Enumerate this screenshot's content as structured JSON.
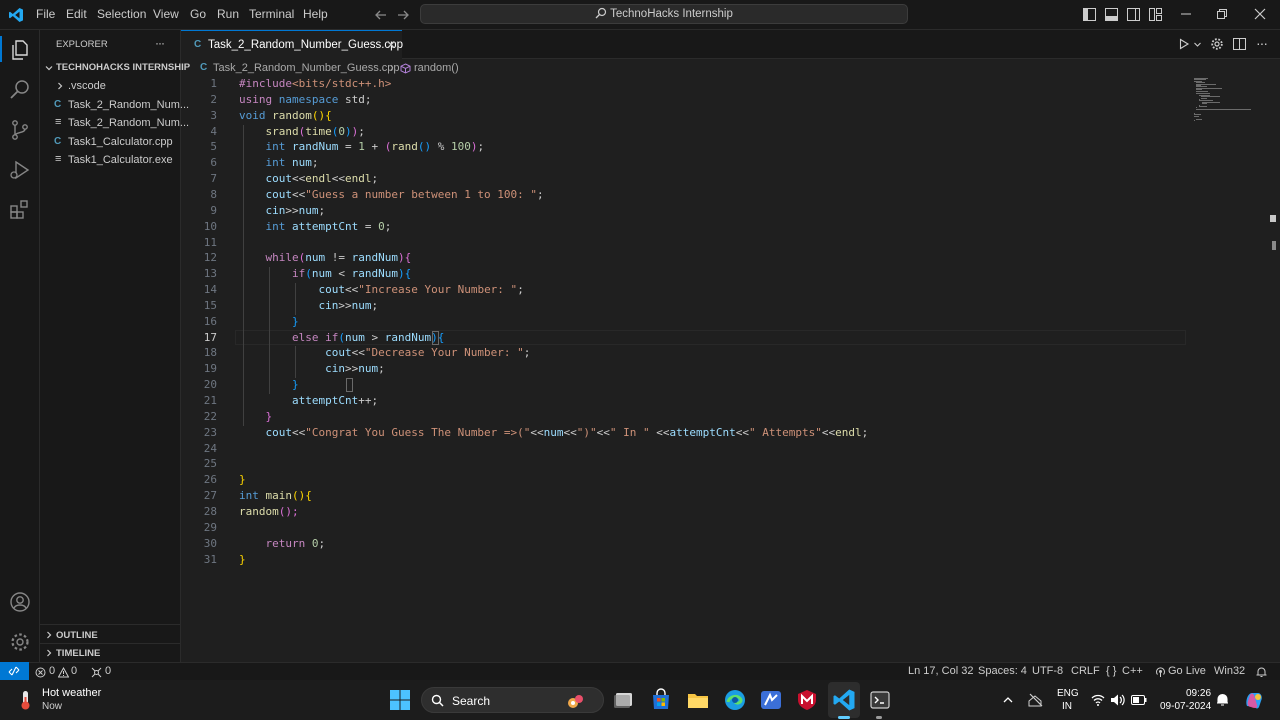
{
  "menu": [
    "File",
    "Edit",
    "Selection",
    "View",
    "Go",
    "Run",
    "Terminal",
    "Help"
  ],
  "search": {
    "text": "TechnoHacks Internship"
  },
  "explorer": {
    "title": "EXPLORER",
    "more": "···",
    "root": "TECHNOHACKS INTERNSHIP",
    "folder": ".vscode",
    "files": [
      "Task_2_Random_Num...",
      "Task_2_Random_Num...",
      "Task1_Calculator.cpp",
      "Task1_Calculator.exe"
    ],
    "outline": "OUTLINE",
    "timeline": "TIMELINE"
  },
  "tab": {
    "title": "Task_2_Random_Number_Guess.cpp",
    "close": "✕"
  },
  "breadcrumb": {
    "file": "Task_2_Random_Number_Guess.cpp",
    "symbol": "random()",
    "separator": "›"
  },
  "editor": {
    "line_numbers": [
      "1",
      "2",
      "3",
      "4",
      "5",
      "6",
      "7",
      "8",
      "9",
      "10",
      "11",
      "12",
      "13",
      "14",
      "15",
      "16",
      "17",
      "18",
      "19",
      "20",
      "21",
      "22",
      "23",
      "24",
      "25",
      "26",
      "27",
      "28",
      "29",
      "30",
      "31"
    ],
    "active_line": 17,
    "code": [
      [
        [
          "#include",
          "pp"
        ],
        [
          "<bits/stdc++.h>",
          "inc"
        ]
      ],
      [
        [
          "using",
          "kc"
        ],
        [
          " ",
          ""
        ],
        [
          "namespace",
          "kw"
        ],
        [
          " std;",
          ""
        ]
      ],
      [
        [
          "void",
          "kw"
        ],
        [
          " ",
          ""
        ],
        [
          "random",
          "fn"
        ],
        [
          "(){",
          "b1"
        ]
      ],
      [
        [
          "    ",
          ""
        ],
        [
          "srand",
          "fn"
        ],
        [
          "(",
          "b2"
        ],
        [
          "time",
          "fn"
        ],
        [
          "(",
          "b3"
        ],
        [
          "0",
          "nm"
        ],
        [
          ")",
          "b3"
        ],
        [
          ")",
          "b2"
        ],
        [
          ";",
          ""
        ]
      ],
      [
        [
          "    ",
          ""
        ],
        [
          "int",
          "kw"
        ],
        [
          " ",
          ""
        ],
        [
          "randNum",
          "vr"
        ],
        [
          " = ",
          ""
        ],
        [
          "1",
          "nm"
        ],
        [
          " + ",
          ""
        ],
        [
          "(",
          "b2"
        ],
        [
          "rand",
          "fn"
        ],
        [
          "()",
          "b3"
        ],
        [
          " % ",
          ""
        ],
        [
          "100",
          "nm"
        ],
        [
          ")",
          "b2"
        ],
        [
          ";",
          ""
        ]
      ],
      [
        [
          "    ",
          ""
        ],
        [
          "int",
          "kw"
        ],
        [
          " ",
          ""
        ],
        [
          "num",
          "vr"
        ],
        [
          ";",
          ""
        ]
      ],
      [
        [
          "    ",
          ""
        ],
        [
          "cout",
          "vr"
        ],
        [
          "<<",
          ""
        ],
        [
          "endl",
          "fn"
        ],
        [
          "<<",
          ""
        ],
        [
          "endl",
          "fn"
        ],
        [
          ";",
          ""
        ]
      ],
      [
        [
          "    ",
          ""
        ],
        [
          "cout",
          "vr"
        ],
        [
          "<<",
          ""
        ],
        [
          "\"Guess a number between 1 to 100: \"",
          "st"
        ],
        [
          ";",
          ""
        ]
      ],
      [
        [
          "    ",
          ""
        ],
        [
          "cin",
          "vr"
        ],
        [
          ">>",
          ""
        ],
        [
          "num",
          "vr"
        ],
        [
          ";",
          ""
        ]
      ],
      [
        [
          "    ",
          ""
        ],
        [
          "int",
          "kw"
        ],
        [
          " ",
          ""
        ],
        [
          "attemptCnt",
          "vr"
        ],
        [
          " = ",
          ""
        ],
        [
          "0",
          "nm"
        ],
        [
          ";",
          ""
        ]
      ],
      [],
      [
        [
          "    ",
          ""
        ],
        [
          "while",
          "kc"
        ],
        [
          "(",
          "b2"
        ],
        [
          "num",
          "vr"
        ],
        [
          " != ",
          ""
        ],
        [
          "randNum",
          "vr"
        ],
        [
          ")",
          "b2"
        ],
        [
          "{",
          "b2"
        ]
      ],
      [
        [
          "        ",
          ""
        ],
        [
          "if",
          "kc"
        ],
        [
          "(",
          "b3"
        ],
        [
          "num",
          "vr"
        ],
        [
          " < ",
          ""
        ],
        [
          "randNum",
          "vr"
        ],
        [
          ")",
          "b3"
        ],
        [
          "{",
          "b3"
        ]
      ],
      [
        [
          "            ",
          ""
        ],
        [
          "cout",
          "vr"
        ],
        [
          "<<",
          ""
        ],
        [
          "\"Increase Your Number: \"",
          "st"
        ],
        [
          ";",
          ""
        ]
      ],
      [
        [
          "            ",
          ""
        ],
        [
          "cin",
          "vr"
        ],
        [
          ">>",
          ""
        ],
        [
          "num",
          "vr"
        ],
        [
          ";",
          ""
        ]
      ],
      [
        [
          "        ",
          ""
        ],
        [
          "}",
          "b3"
        ]
      ],
      [
        [
          "        ",
          ""
        ],
        [
          "else",
          "kc"
        ],
        [
          " ",
          ""
        ],
        [
          "if",
          "kc"
        ],
        [
          "(",
          "b3"
        ],
        [
          "num",
          "vr"
        ],
        [
          " > ",
          ""
        ],
        [
          "randNum",
          "vr"
        ],
        [
          ")",
          "b3"
        ],
        [
          "{",
          "b3"
        ]
      ],
      [
        [
          "             ",
          ""
        ],
        [
          "cout",
          "vr"
        ],
        [
          "<<",
          ""
        ],
        [
          "\"Decrease Your Number: \"",
          "st"
        ],
        [
          ";",
          ""
        ]
      ],
      [
        [
          "             ",
          ""
        ],
        [
          "cin",
          "vr"
        ],
        [
          ">>",
          ""
        ],
        [
          "num",
          "vr"
        ],
        [
          ";",
          ""
        ]
      ],
      [
        [
          "        ",
          ""
        ],
        [
          "}",
          "b3"
        ]
      ],
      [
        [
          "        ",
          ""
        ],
        [
          "attemptCnt",
          "vr"
        ],
        [
          "++;",
          ""
        ]
      ],
      [
        [
          "    ",
          ""
        ],
        [
          "}",
          "b2"
        ]
      ],
      [
        [
          "    ",
          ""
        ],
        [
          "cout",
          "vr"
        ],
        [
          "<<",
          ""
        ],
        [
          "\"Congrat You Guess The Number =>(\"",
          "st"
        ],
        [
          "<<",
          ""
        ],
        [
          "num",
          "vr"
        ],
        [
          "<<",
          ""
        ],
        [
          "\")\"",
          "st"
        ],
        [
          "<<",
          ""
        ],
        [
          "\" In \"",
          "st"
        ],
        [
          " <<",
          ""
        ],
        [
          "attemptCnt",
          "vr"
        ],
        [
          "<<",
          ""
        ],
        [
          "\" Attempts\"",
          "st"
        ],
        [
          "<<",
          ""
        ],
        [
          "endl",
          "fn"
        ],
        [
          ";",
          ""
        ]
      ],
      [],
      [],
      [
        [
          "}",
          "b1"
        ]
      ],
      [
        [
          "int",
          "kw"
        ],
        [
          " ",
          ""
        ],
        [
          "main",
          "fn"
        ],
        [
          "(){",
          "b1"
        ]
      ],
      [
        [
          "random",
          "fn"
        ],
        [
          "();",
          "b2"
        ]
      ],
      [],
      [
        [
          "    ",
          ""
        ],
        [
          "return",
          "kc"
        ],
        [
          " ",
          ""
        ],
        [
          "0",
          "nm"
        ],
        [
          ";",
          ""
        ]
      ],
      [
        [
          "}",
          "b1"
        ]
      ]
    ]
  },
  "status": {
    "errors": "0",
    "warnings": "0",
    "ports": "0",
    "position": "Ln 17, Col 32",
    "spaces": "Spaces: 4",
    "encoding": "UTF-8",
    "eol": "CRLF",
    "lang_icon": "{ }",
    "language": "C++",
    "golive": "Go Live",
    "platform": "Win32"
  },
  "taskbar": {
    "weather_title": "Hot weather",
    "weather_sub": "Now",
    "search": "Search",
    "lang_top": "ENG",
    "lang_bottom": "IN",
    "time": "09:26",
    "date": "09-07-2024"
  },
  "colors": {
    "accent": "#0078d4",
    "remote": "#0078d4",
    "vscode_blue": "#23a9f2"
  }
}
